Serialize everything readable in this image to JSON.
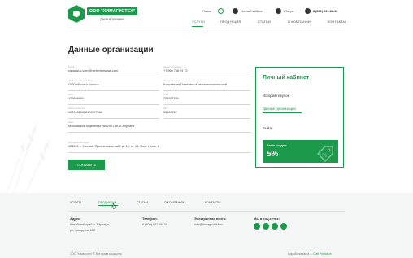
{
  "header": {
    "logo_badge": "ООО \"ХИМАГРОТЕХ\"",
    "logo_sub": "Дело в технике",
    "search_label": "Поиск",
    "cabinet_label": "Личный кабинет",
    "city_label": "г.Тверь",
    "phone": "8 (800) 947-86-19",
    "nav": [
      "УСЛУГИ",
      "ПРОДУКЦИЯ",
      "СТАТЬИ",
      "О КОМПАНИИ",
      "КОНТАКТЫ"
    ]
  },
  "main": {
    "title": "Данные организации",
    "fields": [
      {
        "label": "Email",
        "value": "zakazal-k-vam@himtehtorswas.com"
      },
      {
        "label": "Номер телефона",
        "value": "+7 960 766 74 72"
      },
      {
        "label": "Название организации",
        "value": "ООО «Роса и Колос»"
      },
      {
        "label": "Контактное лицо",
        "value": "Константин Павлович Константинопольский"
      },
      {
        "label": "ИНН",
        "value": "170684861"
      },
      {
        "label": "КПП",
        "value": "724307231"
      },
      {
        "label": "Расчетный счет",
        "value": "40702810028402877168"
      },
      {
        "label": "БИК",
        "value": "55180257"
      },
      {
        "label": "Банк",
        "value": "Московское отделение №8294 ПАО Сбербанк"
      },
      {
        "label": "Юридический адрес",
        "value": "123112, г. Москва, Пресненская наб., д. 10, эт. 41, Пом. I, ком. 6"
      }
    ],
    "save_label": "СОХРАНИТЬ"
  },
  "card": {
    "title": "Личный кабинет",
    "links": [
      "История покупок",
      "Данные организации",
      "Выйти"
    ],
    "discount_label": "Ваша скидка:",
    "discount_value": "5%"
  },
  "footer": {
    "nav": [
      "УСЛУГИ",
      "ПРОДУКЦИЯ",
      "СТАТЬИ",
      "О КОМПАНИИ",
      "КОНТАКТЫ"
    ],
    "address_title": "Адрес:",
    "address_line1": "Алтайский край, г. Барнаул,",
    "address_line2": "ул. Звездная, 13б",
    "phone_title": "Телефон:",
    "phone": "8 (800) 947-86-19",
    "email_title": "Электронная почта:",
    "email": "info@himagrotekh.ru",
    "social_title": "Мы в соц.сетях:",
    "copyright": "ООО \"Химагротех\" © Все права защищены",
    "dev_prefix": "Разработка сайта —",
    "dev_name": "Craft Promotion"
  },
  "colors": {
    "accent": "#1a9a4a"
  }
}
